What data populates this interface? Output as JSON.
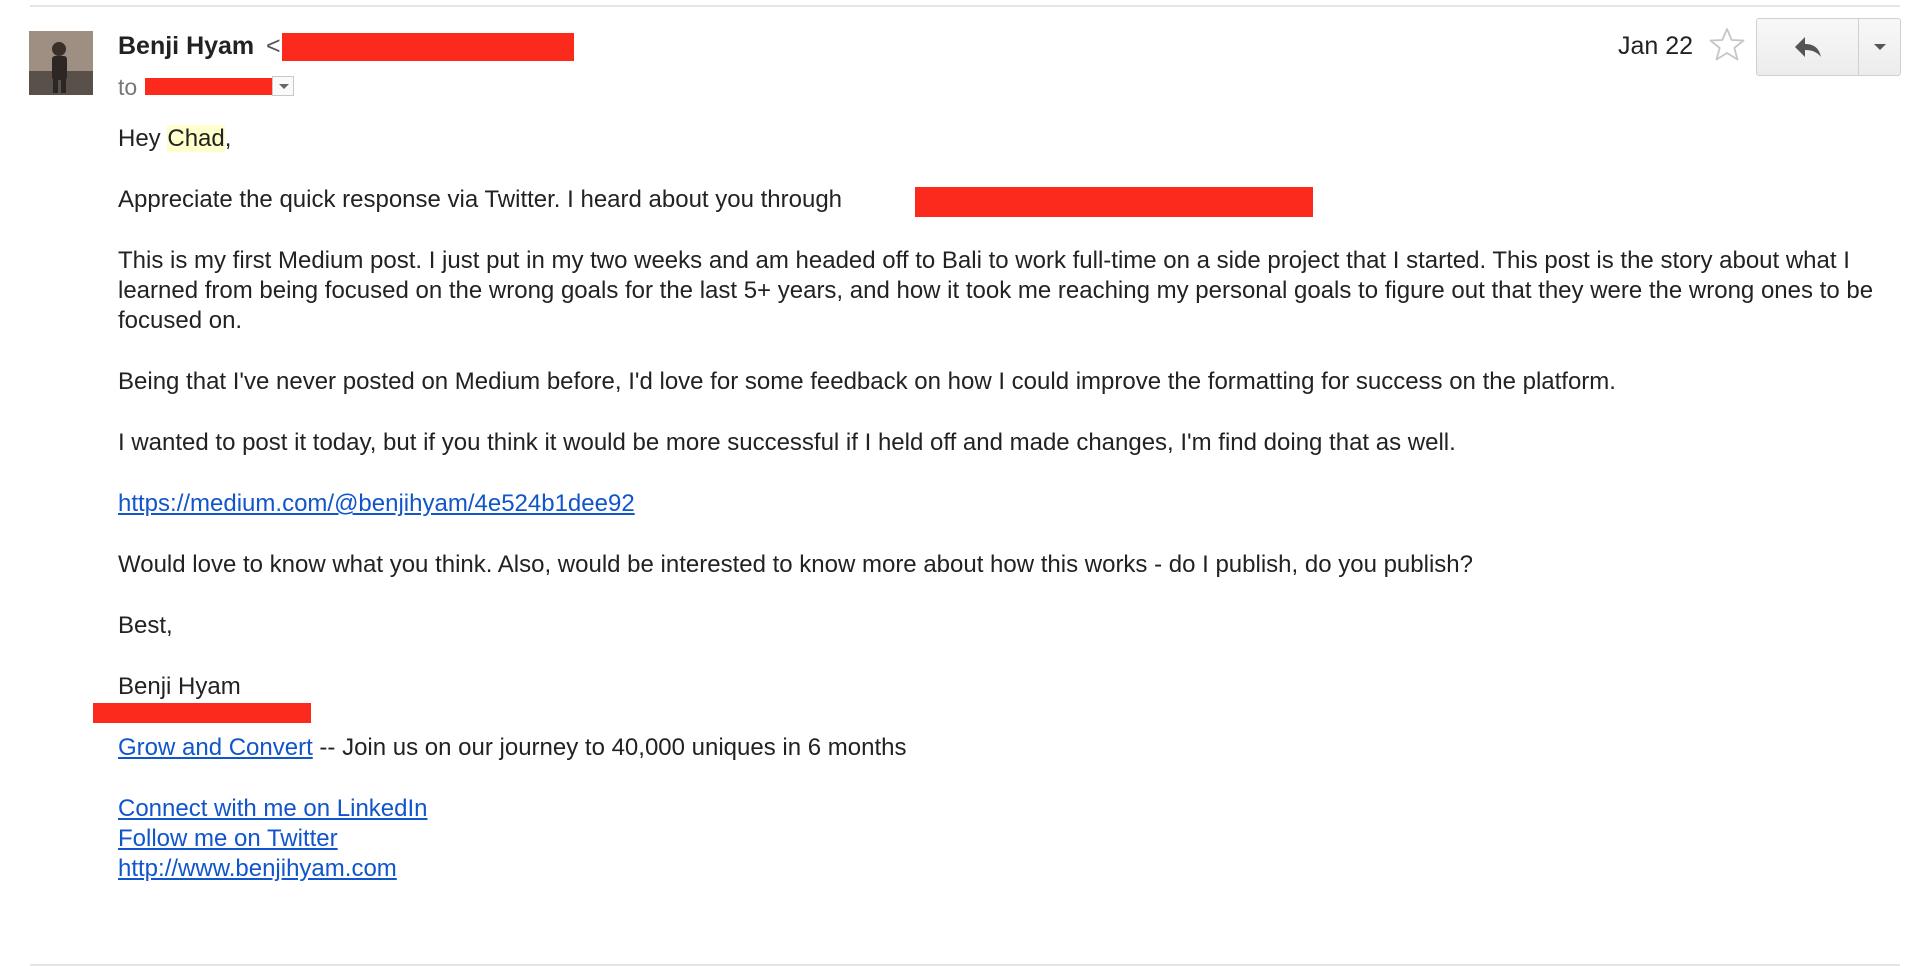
{
  "header": {
    "sender_name": "Benji Hyam",
    "sender_email_prefix": "<",
    "to_prefix": "to",
    "date": "Jan 22",
    "star_icon": "star-outline-icon",
    "reply_icon": "reply-arrow-icon",
    "more_icon": "caret-down-icon"
  },
  "body": {
    "greeting_prefix": "Hey ",
    "greeting_name": "Chad",
    "greeting_suffix": ",",
    "p1": "Appreciate the quick response via Twitter. I heard about you through",
    "p2": "This is my first Medium post. I just put in my two weeks and am headed off to Bali to work full-time on a side project that I started. This post is the story about what I learned from being focused on the wrong goals for the last 5+ years, and how it took me reaching my personal goals to figure out that they were the wrong ones to be focused on.",
    "p3": "Being that I've never posted on Medium before, I'd love for some feedback on how I could improve the formatting for success on the platform.",
    "p4": "I wanted to post it today, but if you think it would be more successful if I held off and made changes, I'm find doing that as well.",
    "link": "https://medium.com/@benjihyam/4e524b1dee92",
    "p5": "Would love to know what you think. Also, would be interested to know more about how this works - do I publish, do you publish?",
    "closing": "Best,",
    "signature_name": "Benji Hyam",
    "company_link": "Grow and Convert",
    "company_tagline": " -- Join us on our journey to 40,000 uniques in 6 months",
    "linkedin_link": "Connect with me on LinkedIn",
    "twitter_link": "Follow me on Twitter",
    "website_link": "http://www.benjihyam.com"
  },
  "colors": {
    "link": "#1155cc",
    "redaction": "#fb2a1d",
    "highlight": "#ffffcc"
  }
}
